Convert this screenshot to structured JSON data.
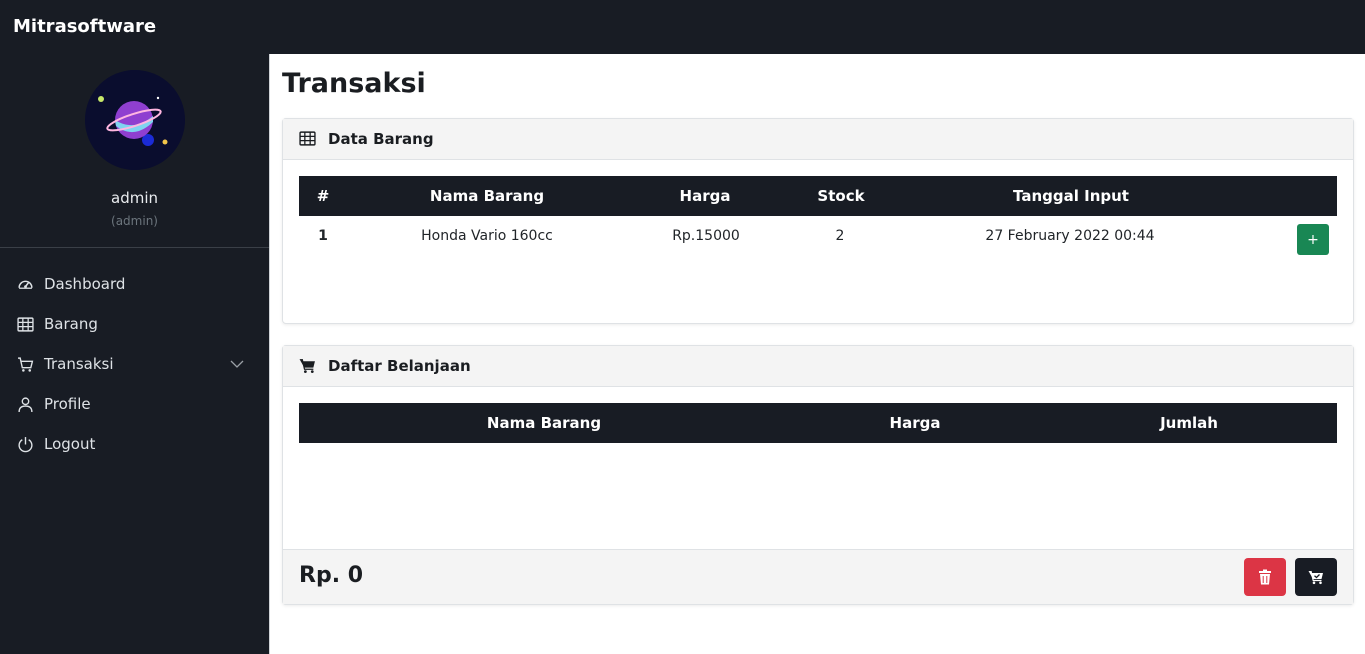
{
  "app": {
    "brand": "Mitrasoftware"
  },
  "user": {
    "name": "admin",
    "role": "(admin)"
  },
  "sidebar": {
    "items": [
      {
        "label": "Dashboard",
        "icon": "speedometer-icon"
      },
      {
        "label": "Barang",
        "icon": "table-icon"
      },
      {
        "label": "Transaksi",
        "icon": "cart-icon",
        "expandable": true
      },
      {
        "label": "Profile",
        "icon": "person-icon"
      },
      {
        "label": "Logout",
        "icon": "power-icon"
      }
    ]
  },
  "page": {
    "title": "Transaksi"
  },
  "data_barang": {
    "title": "Data Barang",
    "columns": [
      "#",
      "Nama Barang",
      "Harga",
      "Stock",
      "Tanggal Input"
    ],
    "rows": [
      {
        "no": "1",
        "nama": "Honda Vario 160cc",
        "harga": "Rp.15000",
        "stock": "2",
        "tanggal": "27 February 2022 00:44",
        "action": "+"
      }
    ]
  },
  "daftar_belanjaan": {
    "title": "Daftar Belanjaan",
    "columns": [
      "Nama Barang",
      "Harga",
      "Jumlah"
    ],
    "rows": [],
    "total": "Rp. 0"
  },
  "colors": {
    "dark": "#181c24",
    "success": "#198754",
    "danger": "#dc3545",
    "card_header": "#f4f4f4"
  }
}
